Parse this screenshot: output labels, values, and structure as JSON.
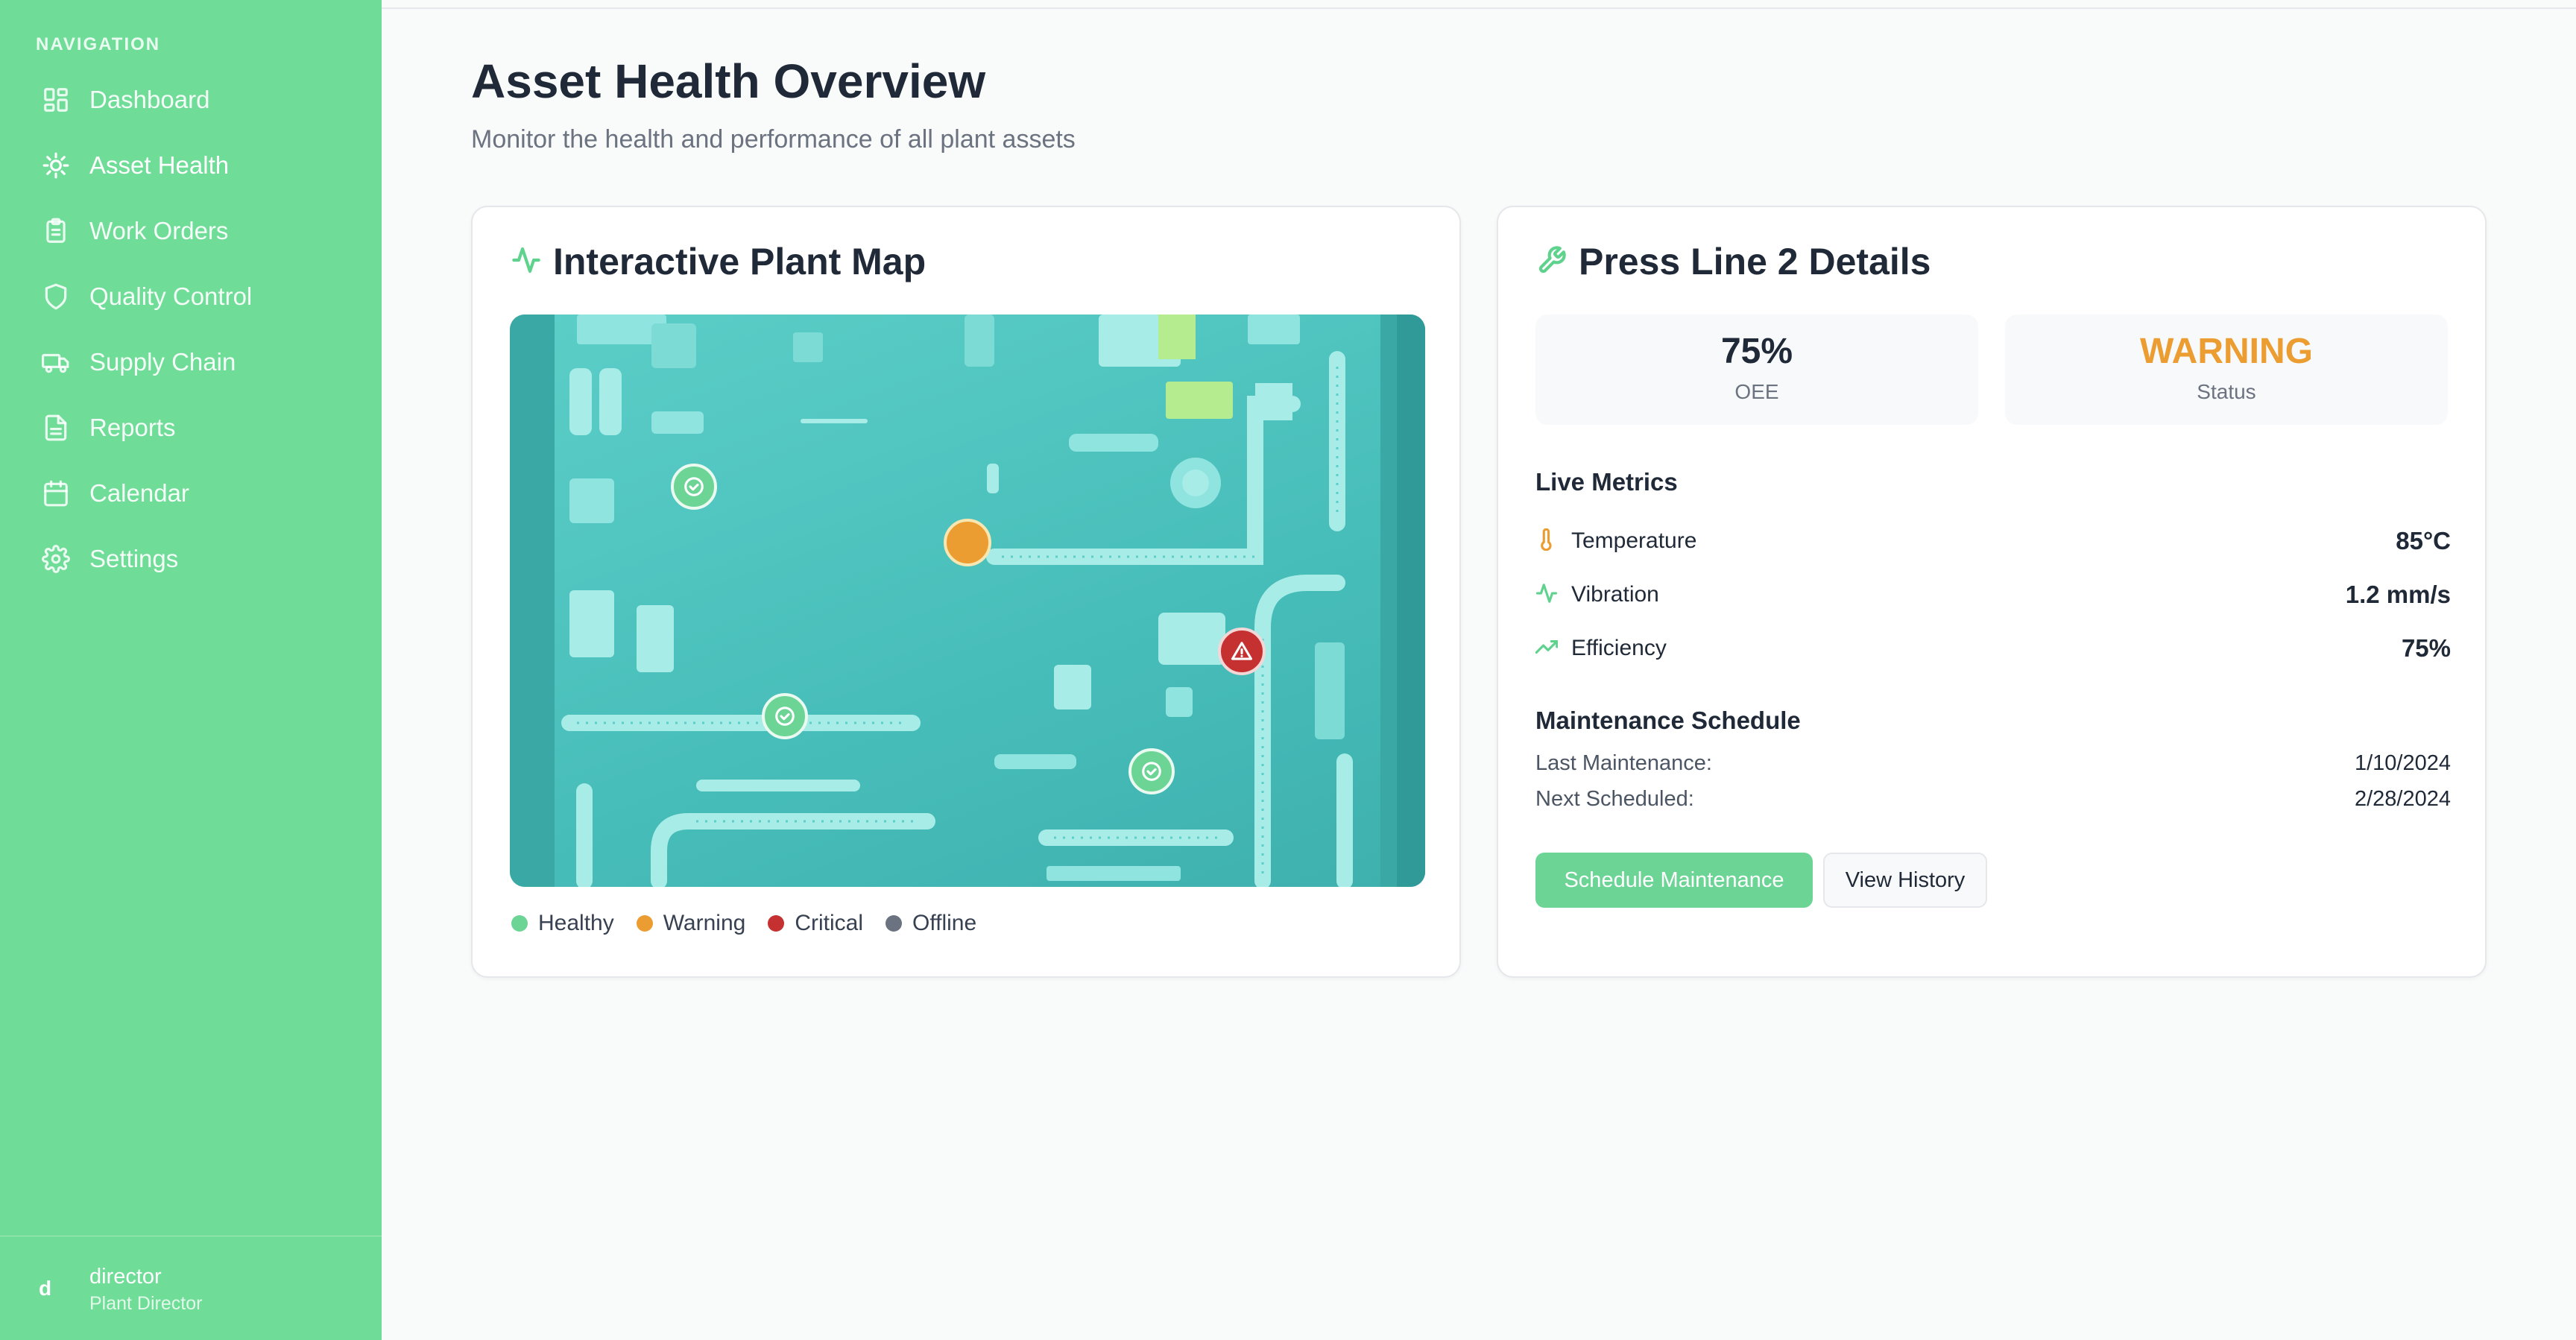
{
  "sidebar": {
    "heading": "NAVIGATION",
    "items": [
      {
        "label": "Dashboard",
        "icon": "dashboard-icon"
      },
      {
        "label": "Asset Health",
        "icon": "gear-icon"
      },
      {
        "label": "Work Orders",
        "icon": "clipboard-icon"
      },
      {
        "label": "Quality Control",
        "icon": "shield-icon"
      },
      {
        "label": "Supply Chain",
        "icon": "truck-icon"
      },
      {
        "label": "Reports",
        "icon": "document-icon"
      },
      {
        "label": "Calendar",
        "icon": "calendar-icon"
      },
      {
        "label": "Settings",
        "icon": "settings-icon"
      }
    ],
    "active": "Asset Health",
    "user": {
      "avatar": "d",
      "name": "director",
      "role": "Plant Director"
    }
  },
  "header": {
    "title": "Asset Health Overview",
    "subtitle": "Monitor the health and performance of all plant assets"
  },
  "map_card": {
    "title": "Interactive Plant Map",
    "markers": [
      {
        "status": "healthy",
        "icon": "check-circle-icon"
      },
      {
        "status": "warning",
        "icon": ""
      },
      {
        "status": "critical",
        "icon": "alert-triangle-icon"
      },
      {
        "status": "healthy",
        "icon": "check-circle-icon"
      },
      {
        "status": "healthy",
        "icon": "check-circle-icon"
      }
    ],
    "legend": [
      {
        "label": "Healthy",
        "color": "#6cd596"
      },
      {
        "label": "Warning",
        "color": "#eb9d32"
      },
      {
        "label": "Critical",
        "color": "#c53030"
      },
      {
        "label": "Offline",
        "color": "#6b7280"
      }
    ]
  },
  "details_card": {
    "title": "Press Line 2 Details",
    "oee": {
      "value": "75%",
      "label": "OEE"
    },
    "status": {
      "value": "WARNING",
      "label": "Status",
      "color": "#eb9d32"
    },
    "live_metrics": {
      "title": "Live Metrics",
      "rows": [
        {
          "label": "Temperature",
          "value": "85°C",
          "icon": "thermometer-icon",
          "color": "#eb9d32"
        },
        {
          "label": "Vibration",
          "value": "1.2 mm/s",
          "icon": "activity-icon",
          "color": "#5fd28d"
        },
        {
          "label": "Efficiency",
          "value": "75%",
          "icon": "trending-up-icon",
          "color": "#5fd28d"
        }
      ]
    },
    "maintenance": {
      "title": "Maintenance Schedule",
      "last_label": "Last Maintenance:",
      "last_value": "1/10/2024",
      "next_label": "Next Scheduled:",
      "next_value": "2/28/2024"
    },
    "buttons": {
      "primary": "Schedule Maintenance",
      "secondary": "View History"
    }
  },
  "colors": {
    "accent": "#6fdc97",
    "warning": "#eb9d32",
    "critical": "#c53030",
    "offline": "#6b7280"
  }
}
